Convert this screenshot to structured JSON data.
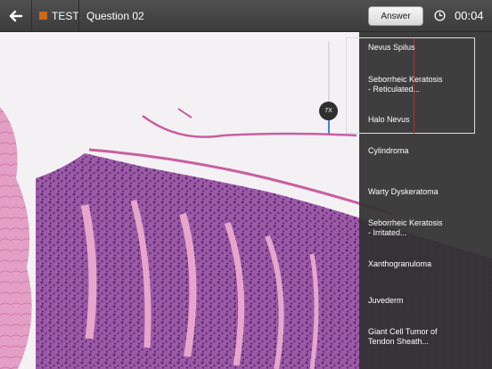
{
  "header": {
    "mode_label": "TEST",
    "question_label": "Question 02",
    "answer_label": "Answer",
    "timer": "00:04"
  },
  "zoom": {
    "label": "7X"
  },
  "answers": [
    {
      "lines": [
        "Nevus Spilus"
      ]
    },
    {
      "lines": [
        "Seborrheic Keratosis",
        "- Reticulated..."
      ]
    },
    {
      "lines": [
        "Halo Nevus"
      ]
    },
    {
      "lines": [
        "Cylindroma"
      ]
    },
    {
      "lines": [
        "Warty Dyskeratoma"
      ]
    },
    {
      "lines": [
        "Seborrheic Keratosis",
        "- Irritated..."
      ]
    },
    {
      "lines": [
        "Xanthogranuloma"
      ]
    },
    {
      "lines": [
        "Juvederm"
      ]
    },
    {
      "lines": [
        "Giant Cell Tumor of",
        "Tendon Sheath..."
      ]
    }
  ],
  "colors": {
    "mode_swatch": "#c9691a",
    "zoom_fill": "#3f83e6",
    "minimap_marker": "#c02a2a"
  },
  "icons": {
    "back": "arrow-left-icon",
    "timer": "clock-icon"
  }
}
